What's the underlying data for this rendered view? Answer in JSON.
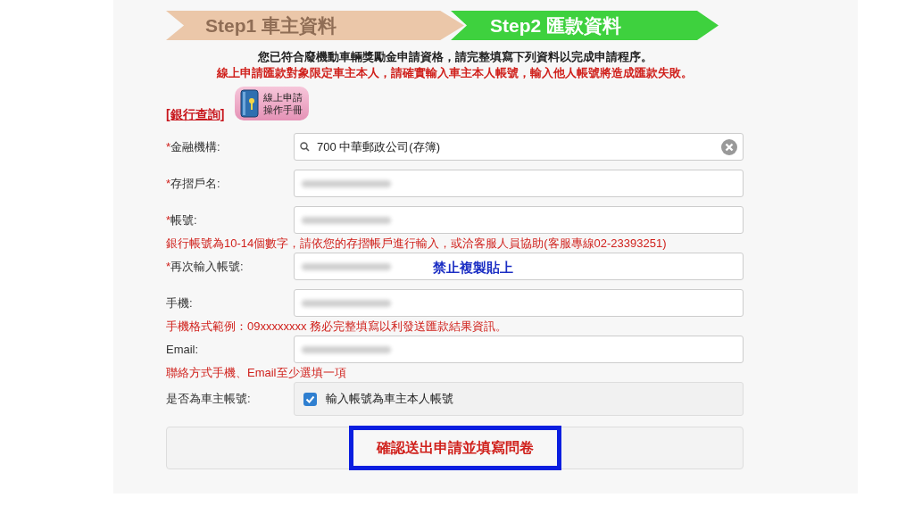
{
  "steps": [
    {
      "label": "Step1 車主資料",
      "selected": false
    },
    {
      "label": "Step2 匯款資料",
      "selected": true
    }
  ],
  "notice": "您已符合廢機動車輛獎勵金申請資格，請完整填寫下列資料以完成申請程序。",
  "warning": "線上申請匯款對象限定車主本人，請確實輸入車主本人帳號，輸入他人帳號將造成匯款失敗。",
  "bank_link": "[銀行查詢]",
  "manual_button": "線上申請操作手冊",
  "fields": [
    {
      "kind": "search",
      "mark": "*",
      "label": "金融機構:",
      "value": "700 中華郵政公司(存簿)"
    },
    {
      "kind": "text",
      "mark": "*",
      "label": "存摺戶名:"
    },
    {
      "kind": "text",
      "mark": "*",
      "label": "帳號:",
      "hint": "銀行帳號為10-14個數字，請依您的存摺帳戶進行輸入，或洽客服人員協助(客服專線02-23393251)"
    },
    {
      "kind": "text",
      "mark": "*",
      "label": "再次輸入帳號:",
      "note": "禁止複製貼上"
    },
    {
      "kind": "text",
      "label": "手機:",
      "hint": "手機格式範例：09xxxxxxxx 務必完整填寫以利發送匯款結果資訊。"
    },
    {
      "kind": "text",
      "label": "Email:",
      "hint": "聯絡方式手機、Email至少選填一項"
    },
    {
      "kind": "checkbox",
      "label": "是否為車主帳號:",
      "option": "輸入帳號為車主本人帳號",
      "checked": true
    }
  ],
  "submit_button": "確認送出申請並填寫問卷"
}
